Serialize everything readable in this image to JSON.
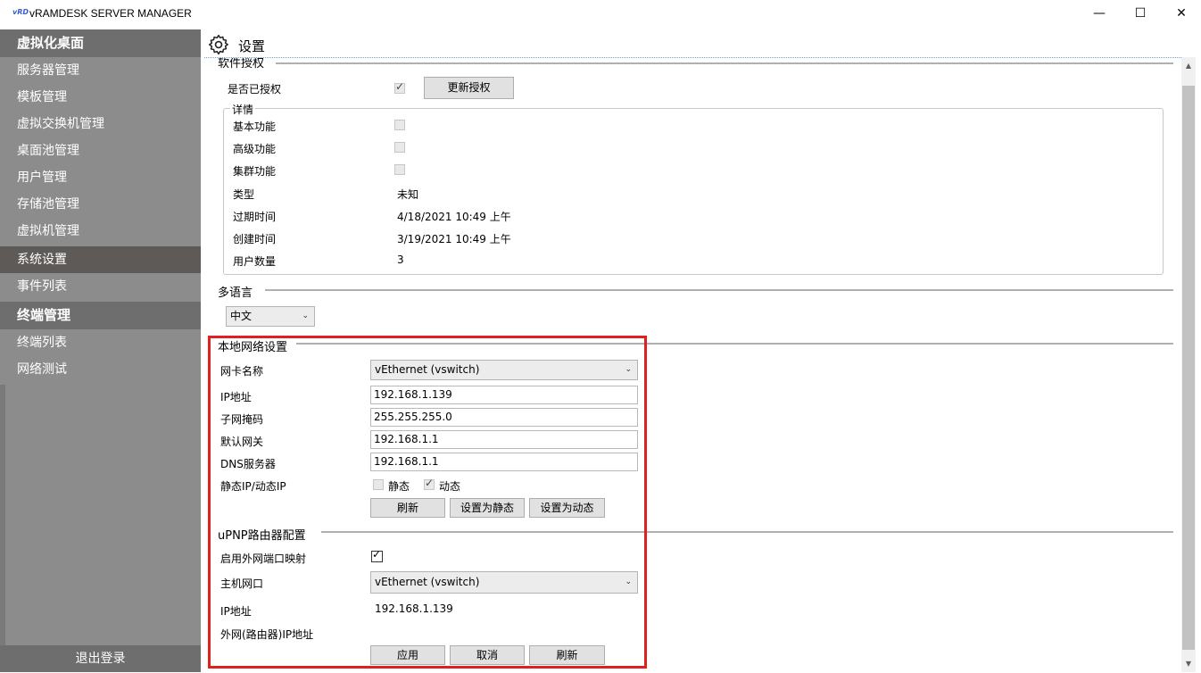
{
  "window": {
    "logo": "vRD",
    "title": "vRAMDESK SERVER MANAGER",
    "minimize": "—",
    "maximize": "☐",
    "close": "✕"
  },
  "sidebar": {
    "group1": "虚拟化桌面",
    "items1": [
      "服务器管理",
      "模板管理",
      "虚拟交换机管理",
      "桌面池管理",
      "用户管理",
      "存储池管理",
      "虚拟机管理",
      "系统设置",
      "事件列表"
    ],
    "group2": "终端管理",
    "items2": [
      "终端列表",
      "网络测试"
    ],
    "logout": "退出登录"
  },
  "header": {
    "gear_icon": "gear-icon",
    "title": "设置"
  },
  "license": {
    "section": "软件授权",
    "authorized_label": "是否已授权",
    "authorized": true,
    "update_button": "更新授权",
    "details_title": "详情",
    "basic_label": "基本功能",
    "advanced_label": "高级功能",
    "cluster_label": "集群功能",
    "type_label": "类型",
    "type_value": "未知",
    "expire_label": "过期时间",
    "expire_value": "4/18/2021 10:49 上午",
    "created_label": "创建时间",
    "created_value": "3/19/2021 10:49 上午",
    "users_label": "用户数量",
    "users_value": "3"
  },
  "language": {
    "section": "多语言",
    "selected": "中文"
  },
  "network": {
    "section": "本地网络设置",
    "nic_label": "网卡名称",
    "nic_value": "vEthernet (vswitch)",
    "ip_label": "IP地址",
    "ip_value": "192.168.1.139",
    "mask_label": "子网掩码",
    "mask_value": "255.255.255.0",
    "gateway_label": "默认网关",
    "gateway_value": "192.168.1.1",
    "dns_label": "DNS服务器",
    "dns_value": "192.168.1.1",
    "mode_label": "静态IP/动态IP",
    "static_label": "静态",
    "dynamic_label": "动态",
    "refresh_button": "刷新",
    "set_static_button": "设置为静态",
    "set_dynamic_button": "设置为动态"
  },
  "upnp": {
    "section": "uPNP路由器配置",
    "enable_label": "启用外网端口映射",
    "enabled": true,
    "host_nic_label": "主机网口",
    "host_nic_value": "vEthernet (vswitch)",
    "ip_label": "IP地址",
    "ip_value": "192.168.1.139",
    "wan_ip_label": "外网(路由器)IP地址",
    "apply_button": "应用",
    "cancel_button": "取消",
    "refresh_button": "刷新"
  },
  "colors": {
    "sidebar": "#8c8c8c",
    "sidebar_header": "#6e6e6e",
    "highlight": "#e0201f"
  }
}
